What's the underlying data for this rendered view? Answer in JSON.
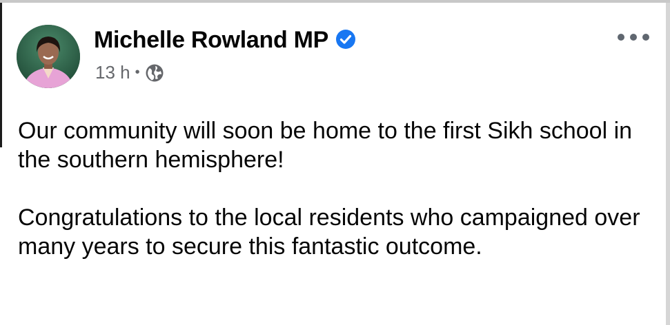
{
  "post": {
    "author_name": "Michelle Rowland MP",
    "verified_icon": "verified-badge-icon",
    "timestamp": "13 h",
    "separator": "•",
    "privacy_icon": "globe-icon",
    "more_icon": "more-options-icon",
    "paragraphs": [
      "Our community will soon be home to the first Sikh school in the southern hemisphere!",
      "Congratulations to the local residents who campaigned over many years to secure this fantastic outcome."
    ]
  },
  "colors": {
    "verified_blue": "#1877f2",
    "meta_gray": "#65676b",
    "text": "#050505"
  }
}
